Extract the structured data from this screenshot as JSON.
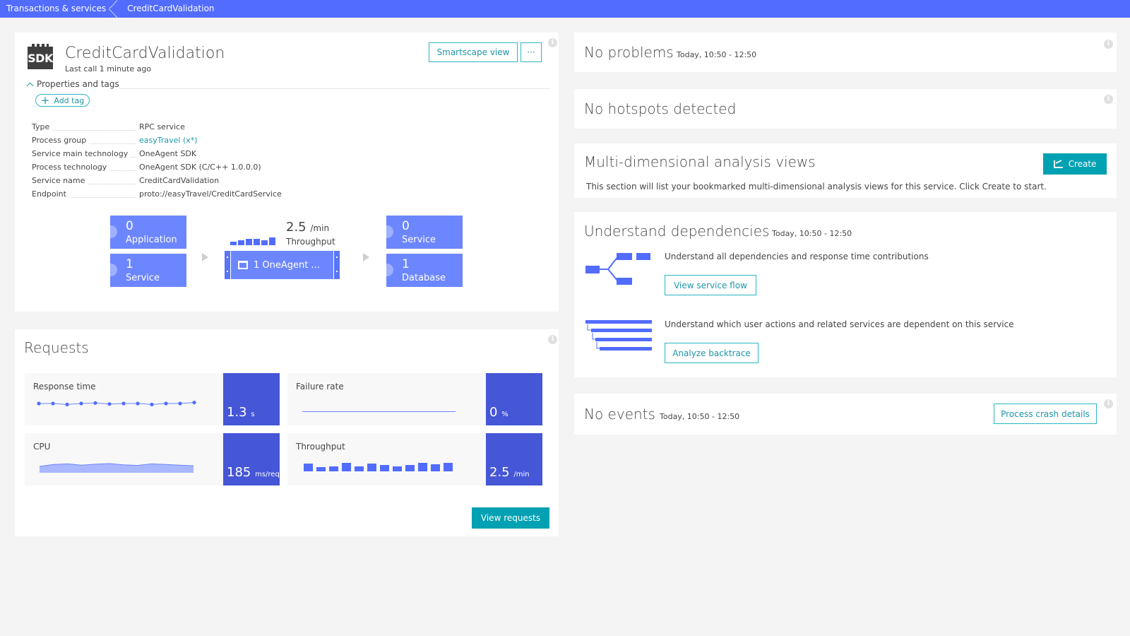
{
  "breadcrumb": {
    "items": [
      "Transactions & services",
      "CreditCardValidation"
    ]
  },
  "service": {
    "icon_label": "SDK",
    "name": "CreditCardValidation",
    "last_call": "Last call 1 minute ago",
    "smartscape_label": "Smartscape view",
    "more_label": "···",
    "properties_label": "Properties and tags",
    "add_tag_label": "Add tag",
    "properties": [
      {
        "key": "Type",
        "value": "RPC service"
      },
      {
        "key": "Process group",
        "value": "easyTravel (x*)"
      },
      {
        "key": "Service main technology",
        "value": "OneAgent SDK"
      },
      {
        "key": "Process technology",
        "value": "OneAgent SDK (C/C++ 1.0.0.0)"
      },
      {
        "key": "Service name",
        "value": "CreditCardValidation"
      },
      {
        "key": "Endpoint",
        "value": "proto://easyTravel/CreditCardService"
      }
    ]
  },
  "smartscape": {
    "callers": [
      {
        "count": "0",
        "label": "Application"
      },
      {
        "count": "1",
        "label": "Service"
      }
    ],
    "throughput_value": "2.5",
    "throughput_unit": "/min",
    "throughput_label": "Throughput",
    "process_group_label": "1 OneAgent ...",
    "callees": [
      {
        "count": "0",
        "label": "Service"
      },
      {
        "count": "1",
        "label": "Database"
      }
    ],
    "mini_bar_levels": [
      0.45,
      0.65,
      0.85,
      0.85,
      0.6,
      1.0
    ]
  },
  "requests": {
    "title": "Requests",
    "metrics": [
      {
        "label": "Response time",
        "value": "1.3",
        "unit": "s"
      },
      {
        "label": "Failure rate",
        "value": "0",
        "unit": "%"
      },
      {
        "label": "CPU",
        "value": "185",
        "unit": "ms/req"
      },
      {
        "label": "Throughput",
        "value": "2.5",
        "unit": "/min"
      }
    ],
    "view_requests_label": "View requests",
    "response_time_points": [
      1.3,
      1.3,
      1.28,
      1.3,
      1.31,
      1.29,
      1.3,
      1.3,
      1.28,
      1.3,
      1.3,
      1.32
    ],
    "cpu_points": [
      180,
      186,
      188,
      184,
      187,
      189,
      185,
      183,
      188,
      186,
      184,
      182
    ],
    "throughput_bars": [
      0.9,
      0.5,
      0.6,
      1.0,
      0.6,
      0.95,
      0.75,
      0.6,
      0.75,
      1.0,
      0.8,
      1.0
    ]
  },
  "problems": {
    "title": "No problems",
    "timeframe": "Today, 10:50 - 12:50"
  },
  "hotspots": {
    "title": "No hotspots detected"
  },
  "mda": {
    "title": "Multi-dimensional analysis views",
    "create_label": "Create",
    "description": "This section will list your bookmarked multi-dimensional analysis views for this service. Click Create to start."
  },
  "dependencies": {
    "title": "Understand dependencies",
    "timeframe": "Today, 10:50 - 12:50",
    "flow_text": "Understand all dependencies and response time contributions",
    "flow_button": "View service flow",
    "backtrace_text": "Understand which user actions and related services are dependent on this service",
    "backtrace_button": "Analyze backtrace"
  },
  "events": {
    "title": "No events",
    "timeframe": "Today, 10:50 - 12:50",
    "crash_button": "Process crash details"
  },
  "colors": {
    "brand": "#526cff",
    "tile": "#6c86ff",
    "metric": "#4556d7",
    "accent": "#00a1b2"
  }
}
